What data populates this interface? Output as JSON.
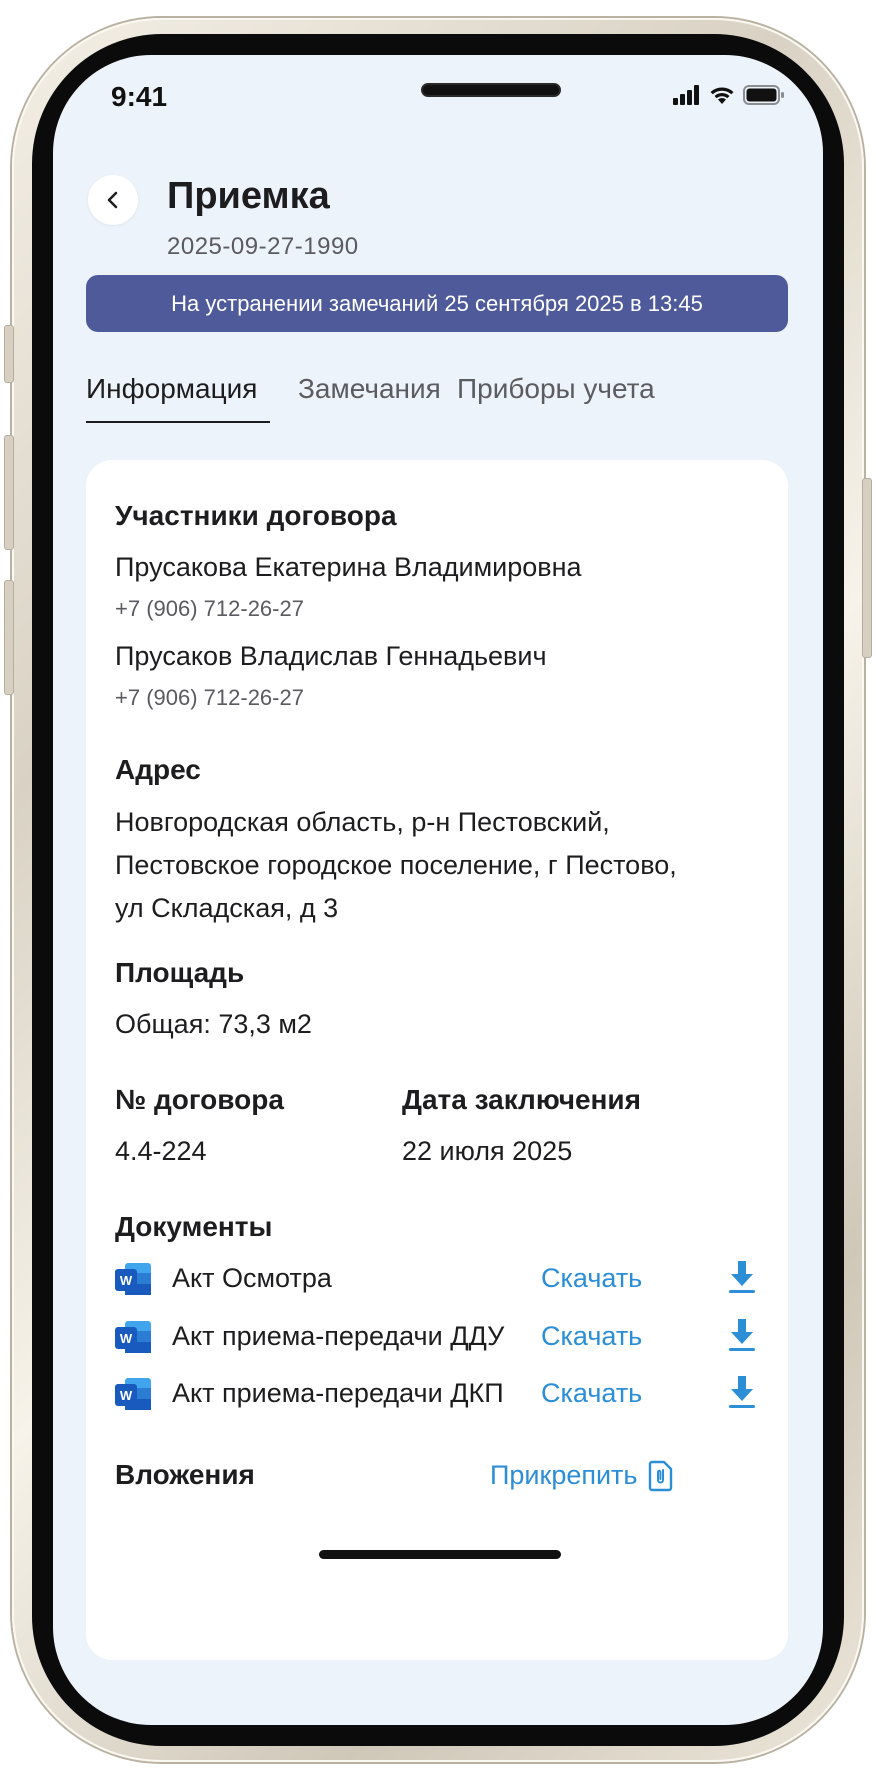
{
  "status_bar": {
    "time": "9:41"
  },
  "header": {
    "title": "Приемка",
    "subtitle": "2025-09-27-1990"
  },
  "banner": {
    "text": "На устранении замечаний 25 сентября 2025 в 13:45",
    "color": "#4f5a9a"
  },
  "tabs": [
    {
      "label": "Информация",
      "active": true
    },
    {
      "label": "Замечания",
      "active": false
    },
    {
      "label": "Приборы учета",
      "active": false
    }
  ],
  "participants": {
    "title": "Участники договора",
    "people": [
      {
        "name": "Прусакова Екатерина Владимировна",
        "phone": "+7 (906) 712-26-27"
      },
      {
        "name": "Прусаков Владислав Геннадьевич",
        "phone": "+7 (906) 712-26-27"
      }
    ]
  },
  "address": {
    "title": "Адрес",
    "lines": [
      "Новгородская область, р-н Пестовский,",
      "Пестовское городское поселение, г Пестово,",
      "ул Складская, д 3"
    ]
  },
  "area": {
    "title": "Площадь",
    "value": "Общая: 73,3 м2"
  },
  "contract": {
    "number_label": "№ договора",
    "number": "4.4-224",
    "date_label": "Дата заключения",
    "date": "22 июля 2025"
  },
  "documents": {
    "title": "Документы",
    "download_label": "Скачать",
    "items": [
      {
        "name": "Акт Осмотра",
        "icon": "word-doc-icon"
      },
      {
        "name": "Акт приема-передачи ДДУ",
        "icon": "word-doc-icon"
      },
      {
        "name": "Акт приема-передачи ДКП",
        "icon": "word-doc-icon"
      }
    ]
  },
  "attachments": {
    "title": "Вложения",
    "attach_label": "Прикрепить"
  },
  "colors": {
    "accent": "#2b8ed6",
    "background": "#edf3fa",
    "banner": "#4f5a9a"
  }
}
